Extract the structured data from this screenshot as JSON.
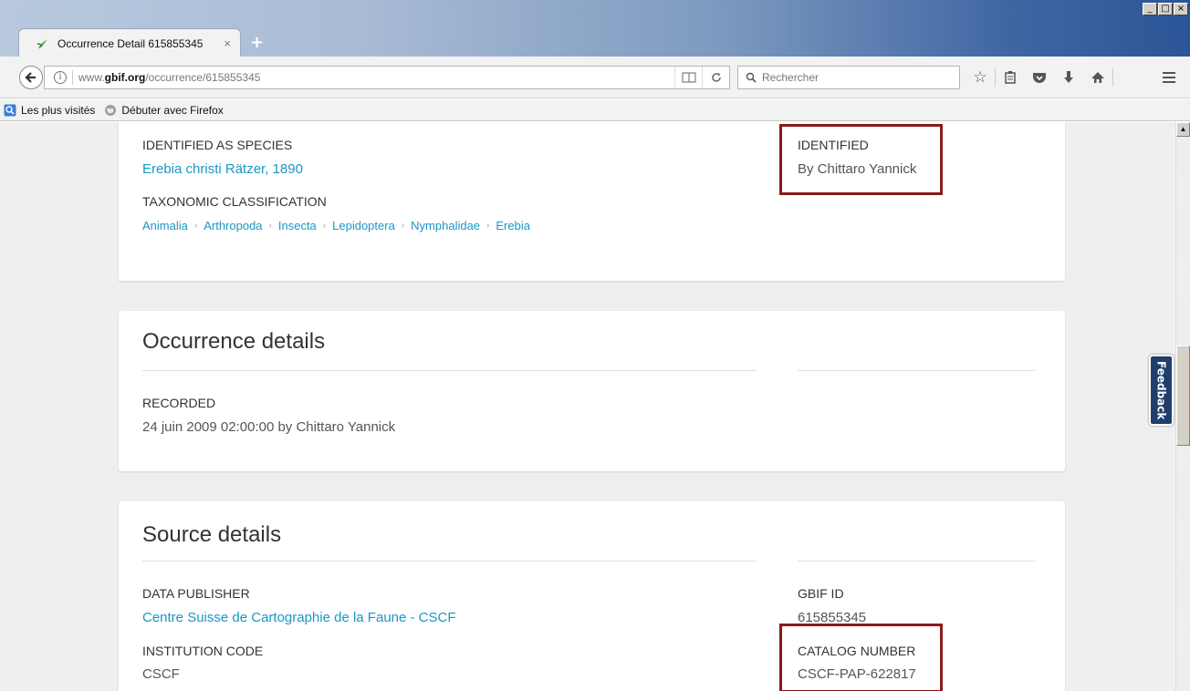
{
  "browser": {
    "tab_title": "Occurrence Detail 615855345",
    "tab_close": "×",
    "new_tab": "+",
    "url_prefix": "www.",
    "url_domain": "gbif.org",
    "url_path": "/occurrence/615855345",
    "search_placeholder": "Rechercher",
    "window_controls": [
      "_",
      "□",
      "×"
    ],
    "bookmarks": [
      {
        "label": "Les plus visités",
        "icon": "most-visited-icon"
      },
      {
        "label": "Débuter avec Firefox",
        "icon": "firefox-globe-icon"
      }
    ]
  },
  "identification": {
    "species_label": "IDENTIFIED AS SPECIES",
    "species_value": "Erebia christi Rätzer, 1890",
    "classification_label": "TAXONOMIC CLASSIFICATION",
    "classification": [
      "Animalia",
      "Arthropoda",
      "Insecta",
      "Lepidoptera",
      "Nymphalidae",
      "Erebia"
    ],
    "identified_label": "IDENTIFIED",
    "identified_value": "By Chittaro Yannick"
  },
  "occurrence": {
    "title": "Occurrence details",
    "recorded_label": "RECORDED",
    "recorded_value": "24 juin 2009 02:00:00 by Chittaro Yannick"
  },
  "source": {
    "title": "Source details",
    "publisher_label": "DATA PUBLISHER",
    "publisher_value": "Centre Suisse de Cartographie de la Faune - CSCF",
    "institution_label": "INSTITUTION CODE",
    "institution_value": "CSCF",
    "gbif_id_label": "GBIF ID",
    "gbif_id_value": "615855345",
    "catalog_label": "CATALOG NUMBER",
    "catalog_value": "CSCF-PAP-622817"
  },
  "feedback_label": "Feedback",
  "colors": {
    "link": "#1a97c4",
    "highlight": "#8b1a1a",
    "feedback_bg": "#1f3e6b"
  }
}
